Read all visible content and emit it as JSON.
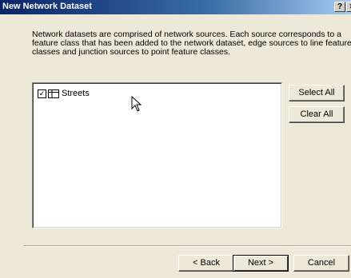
{
  "window": {
    "title": "New Network Dataset",
    "help_label": "?",
    "close_label": "×"
  },
  "description": {
    "line1": "Network datasets are comprised of network sources.  Each source corresponds to a",
    "line2": "feature class that has been added to the network dataset, edge sources to line feature",
    "line3": "classes and junction sources to point feature classes."
  },
  "sources": [
    {
      "label": "Streets",
      "checked": true,
      "check_glyph": "✓"
    }
  ],
  "buttons": {
    "select_all": "Select All",
    "clear_all": "Clear All",
    "back": "< Back",
    "next": "Next >",
    "cancel": "Cancel"
  },
  "colors": {
    "dialog_bg": "#ece9d8",
    "titlebar": "#0a246a"
  }
}
